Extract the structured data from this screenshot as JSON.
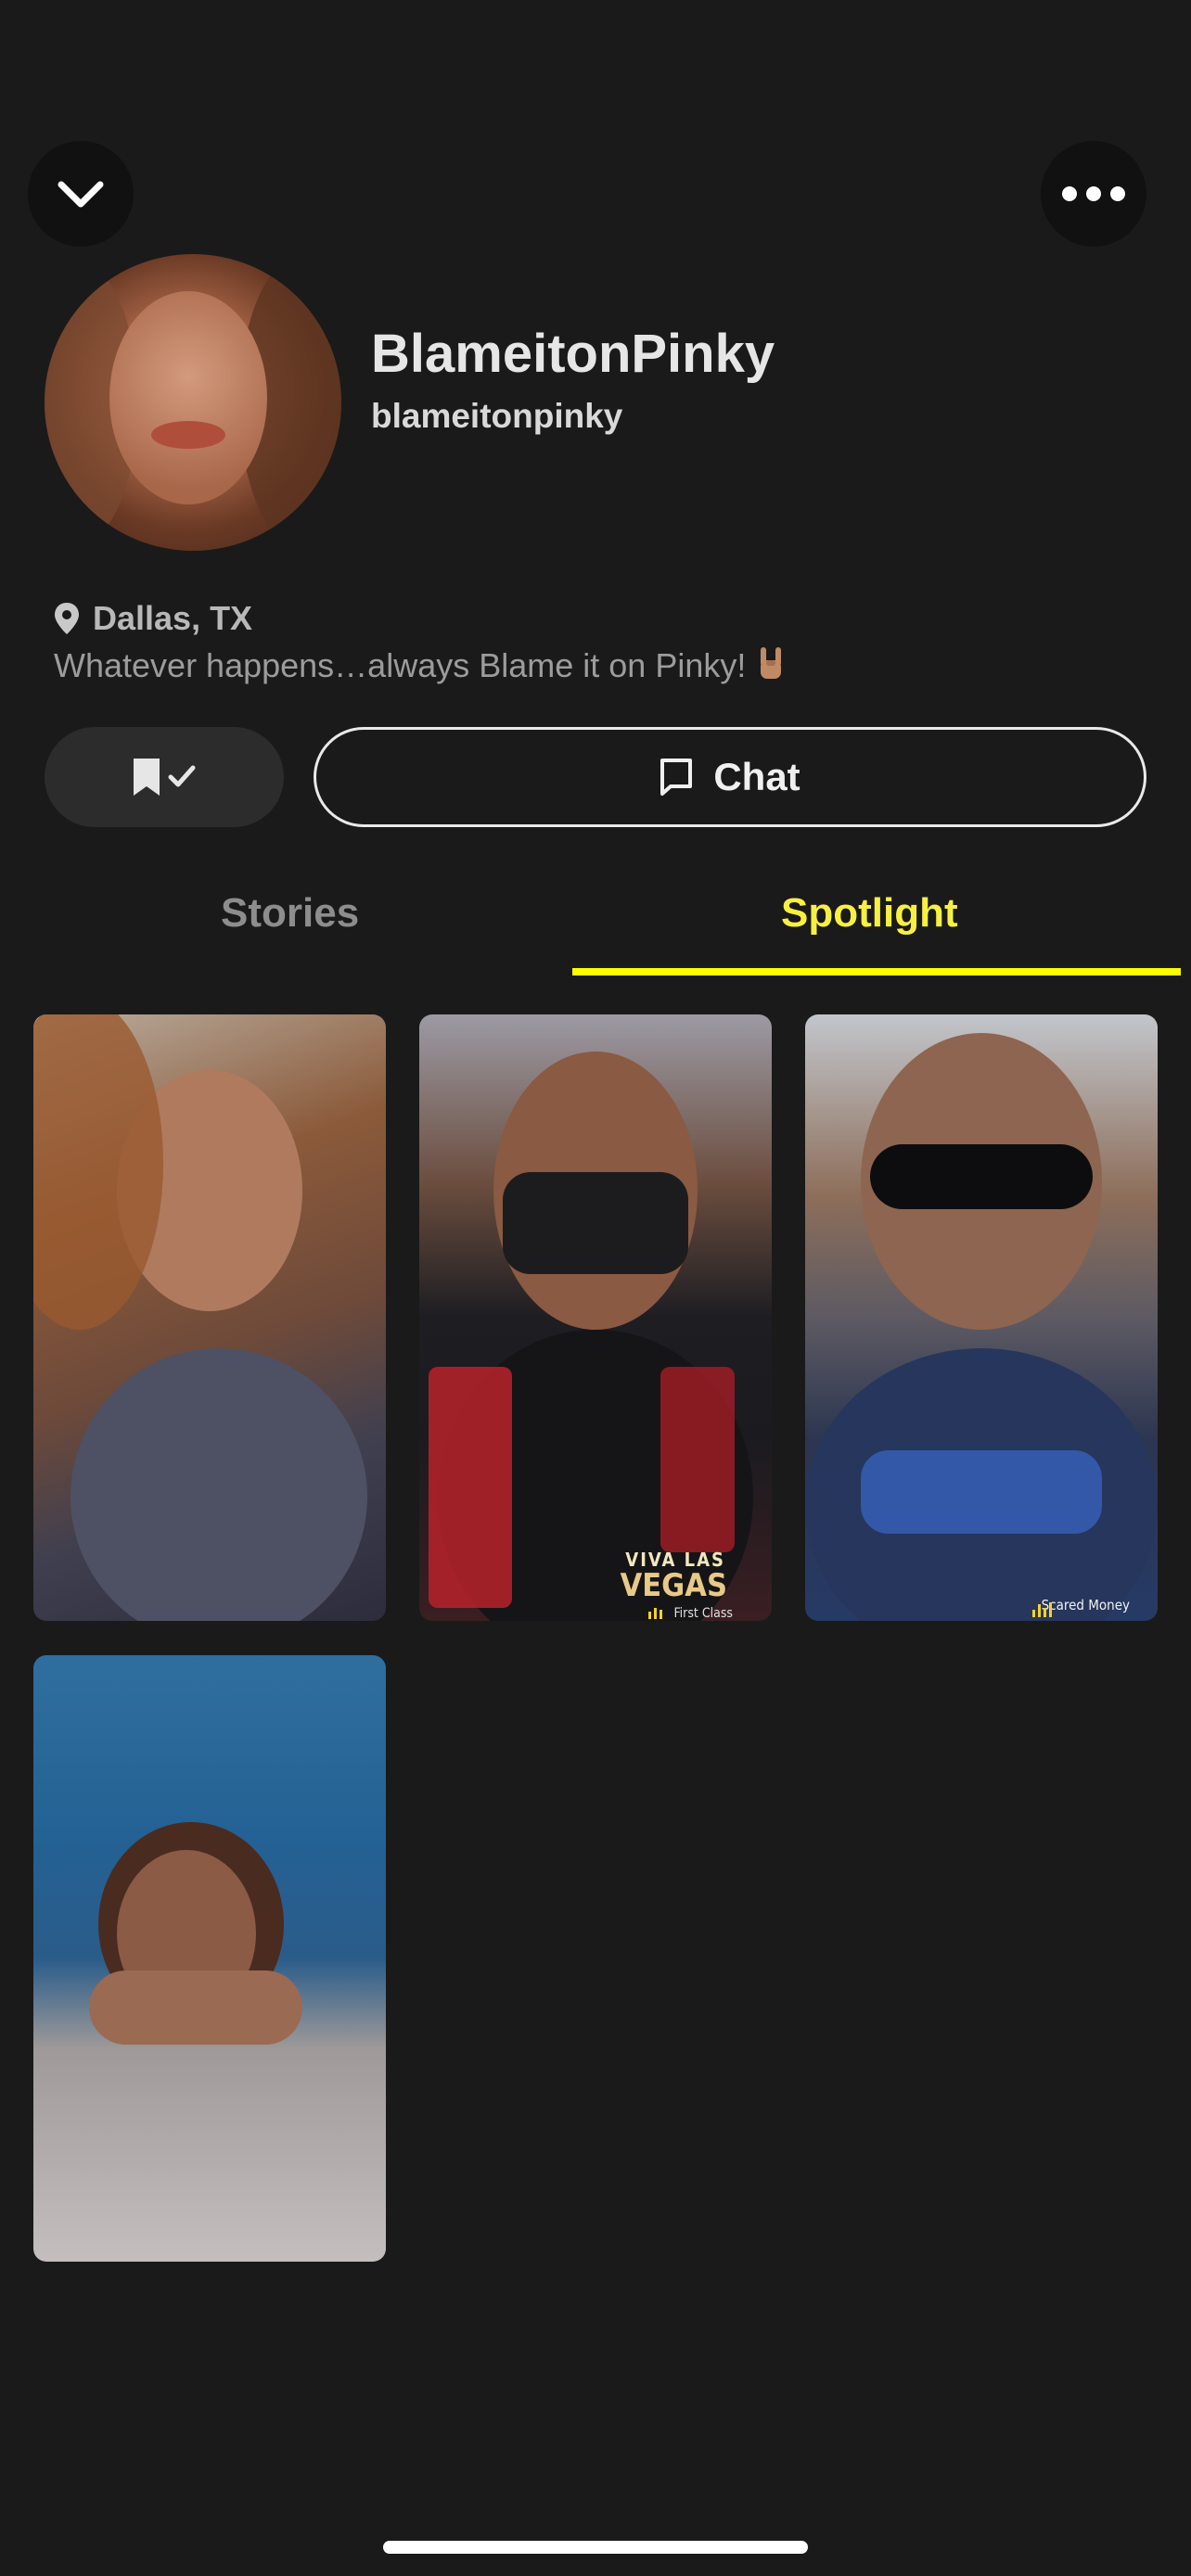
{
  "header": {
    "collapse_icon": "chevron-down-icon",
    "more_icon": "ellipsis-icon"
  },
  "profile": {
    "display_name": "BlameitonPinky",
    "username": "blameitonpinky",
    "location": "Dallas, TX",
    "bio": "Whatever happens…always Blame it on Pinky!",
    "bio_emoji": "rock-on-hand-emoji"
  },
  "actions": {
    "save_icon": "bookmark-check-icon",
    "chat_label": "Chat",
    "chat_icon": "chat-bubble-icon"
  },
  "tabs": [
    {
      "label": "Stories",
      "active": false
    },
    {
      "label": "Spotlight",
      "active": true
    }
  ],
  "spotlight": {
    "tiles": [
      {
        "id": "tile-1",
        "caption": ""
      },
      {
        "id": "tile-2",
        "caption_line1": "VIVA LAS",
        "caption_line2": "VEGAS",
        "caption_sub": "First Class"
      },
      {
        "id": "tile-3",
        "caption": "Scared Money"
      },
      {
        "id": "tile-4",
        "caption": ""
      }
    ]
  },
  "colors": {
    "background": "#1a1a1a",
    "accent_yellow": "#fffc00",
    "spotlight_label": "#f7f043"
  }
}
